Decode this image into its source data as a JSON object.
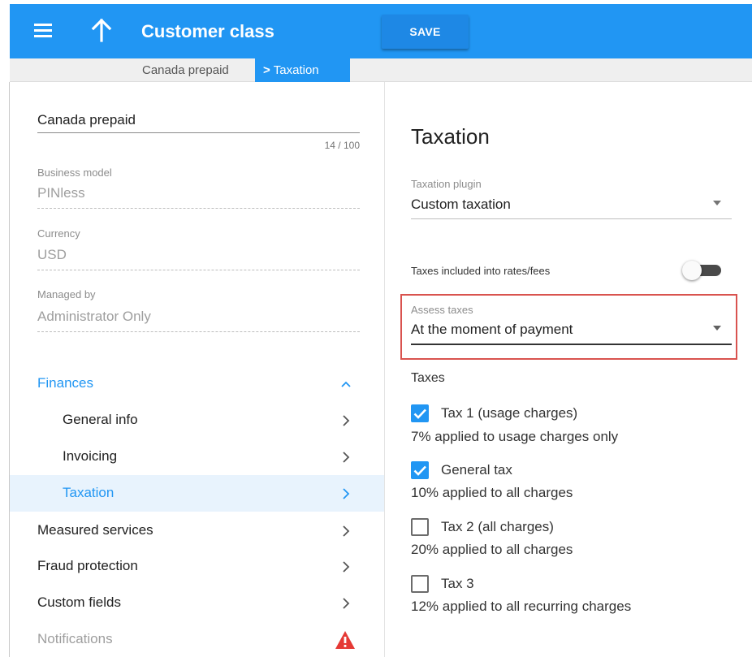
{
  "header": {
    "title": "Customer class",
    "save_label": "SAVE",
    "color": "#2196f3"
  },
  "breadcrumb": {
    "parent": "Canada prepaid",
    "current": "Taxation"
  },
  "left": {
    "name_value": "Canada prepaid",
    "name_counter": "14 / 100",
    "fields": [
      {
        "label": "Business model",
        "value": "PINless"
      },
      {
        "label": "Currency",
        "value": "USD"
      },
      {
        "label": "Managed by",
        "value": "Administrator Only"
      }
    ],
    "nav": {
      "finances": "Finances",
      "general_info": "General info",
      "invoicing": "Invoicing",
      "taxation": "Taxation",
      "measured_services": "Measured services",
      "fraud_protection": "Fraud protection",
      "custom_fields": "Custom fields",
      "notifications": "Notifications"
    }
  },
  "right": {
    "title": "Taxation",
    "plugin": {
      "label": "Taxation plugin",
      "value": "Custom taxation"
    },
    "toggle": {
      "label": "Taxes included into rates/fees",
      "on": false
    },
    "assess": {
      "label": "Assess taxes",
      "value": "At the moment of payment",
      "highlight_color": "#d9534f"
    },
    "taxes_heading": "Taxes",
    "taxes": [
      {
        "name": "Tax 1 (usage charges)",
        "desc": "7% applied to usage charges only",
        "checked": true
      },
      {
        "name": "General tax",
        "desc": "10% applied to all charges",
        "checked": true
      },
      {
        "name": "Tax 2 (all charges)",
        "desc": "20% applied to all charges",
        "checked": false
      },
      {
        "name": "Tax 3",
        "desc": "12% applied to all recurring charges",
        "checked": false
      }
    ]
  },
  "icons": [
    "menu-icon",
    "arrow-up-icon",
    "chevron-right-icon",
    "chevron-up-icon",
    "dropdown-arrow-icon",
    "check-icon",
    "warning-icon"
  ]
}
